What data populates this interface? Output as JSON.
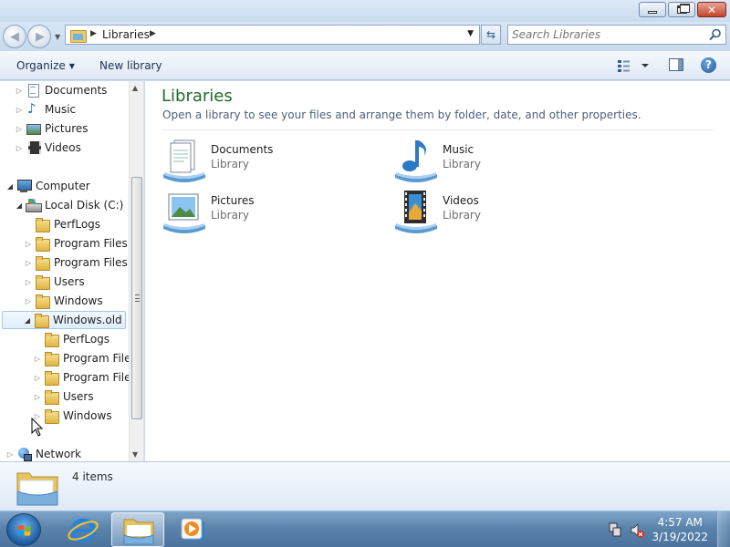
{
  "window": {
    "minimize_label": "Minimize",
    "maximize_label": "Restore",
    "close_label": "Close"
  },
  "address": {
    "path": [
      "Libraries"
    ],
    "search_placeholder": "Search Libraries"
  },
  "command_bar": {
    "organize_label": "Organize",
    "new_library_label": "New library"
  },
  "nav_tree": [
    {
      "label": "Documents",
      "icon": "documents-library-icon",
      "level": 1,
      "expander": "collapsed"
    },
    {
      "label": "Music",
      "icon": "music-library-icon",
      "level": 1,
      "expander": "collapsed"
    },
    {
      "label": "Pictures",
      "icon": "pictures-library-icon",
      "level": 1,
      "expander": "collapsed"
    },
    {
      "label": "Videos",
      "icon": "videos-library-icon",
      "level": 1,
      "expander": "collapsed"
    },
    {
      "label": "Computer",
      "icon": "computer-icon",
      "level": 0,
      "expander": "expanded"
    },
    {
      "label": "Local Disk (C:)",
      "icon": "local-disk-icon",
      "level": 1,
      "expander": "expanded"
    },
    {
      "label": "PerfLogs",
      "icon": "folder-icon",
      "level": 2,
      "expander": "none"
    },
    {
      "label": "Program Files",
      "icon": "folder-icon",
      "level": 2,
      "expander": "collapsed"
    },
    {
      "label": "Program Files (",
      "icon": "folder-icon",
      "level": 2,
      "expander": "collapsed"
    },
    {
      "label": "Users",
      "icon": "folder-icon",
      "level": 2,
      "expander": "collapsed"
    },
    {
      "label": "Windows",
      "icon": "folder-icon",
      "level": 2,
      "expander": "collapsed"
    },
    {
      "label": "Windows.old",
      "icon": "folder-icon",
      "level": 2,
      "expander": "expanded",
      "selected": true
    },
    {
      "label": "PerfLogs",
      "icon": "folder-icon",
      "level": 3,
      "expander": "none"
    },
    {
      "label": "Program Files",
      "icon": "folder-icon",
      "level": 3,
      "expander": "collapsed"
    },
    {
      "label": "Program Files",
      "icon": "folder-icon",
      "level": 3,
      "expander": "collapsed"
    },
    {
      "label": "Users",
      "icon": "folder-icon",
      "level": 3,
      "expander": "collapsed"
    },
    {
      "label": "Windows",
      "icon": "folder-icon",
      "level": 3,
      "expander": "collapsed"
    },
    {
      "label": "Network",
      "icon": "network-icon",
      "level": 0,
      "expander": "collapsed"
    }
  ],
  "main": {
    "title": "Libraries",
    "subtitle": "Open a library to see your files and arrange them by folder, date, and other properties.",
    "libraries": [
      {
        "name": "Documents",
        "type": "Library",
        "icon": "documents-library-icon"
      },
      {
        "name": "Music",
        "type": "Library",
        "icon": "music-library-icon"
      },
      {
        "name": "Pictures",
        "type": "Library",
        "icon": "pictures-library-icon"
      },
      {
        "name": "Videos",
        "type": "Library",
        "icon": "videos-library-icon"
      }
    ]
  },
  "details": {
    "item_count": "4 items"
  },
  "taskbar": {
    "apps": [
      "internet-explorer-icon",
      "windows-explorer-icon",
      "windows-media-player-icon"
    ],
    "time": "4:57 AM",
    "date": "3/19/2022"
  },
  "colors": {
    "title_green": "#1e6b2a",
    "taskbar_blue": "#5b84ad"
  }
}
